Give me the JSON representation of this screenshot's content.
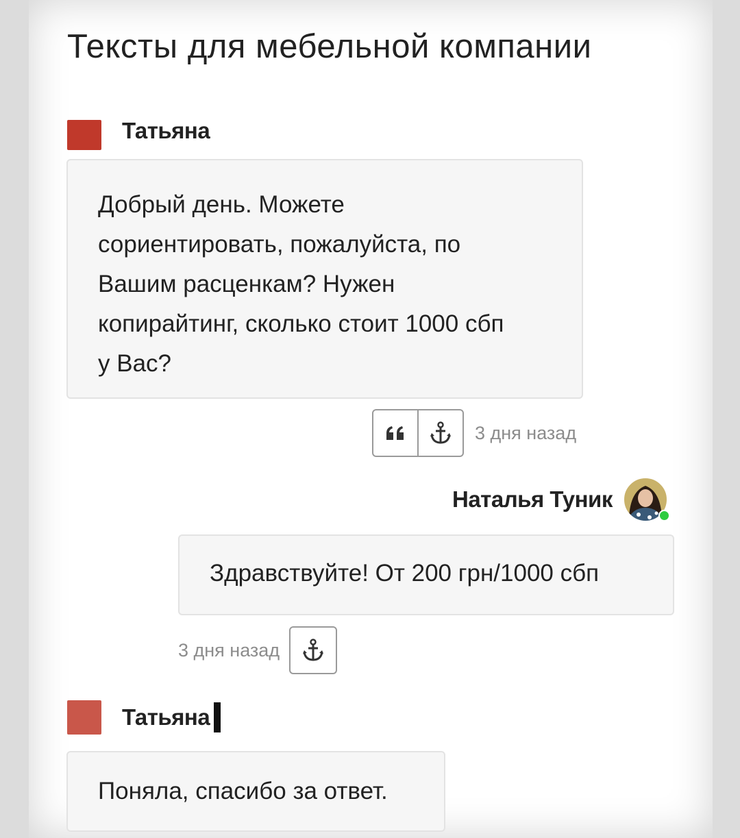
{
  "page": {
    "title": "Тексты для мебельной компании"
  },
  "messages": [
    {
      "author": "Татьяна",
      "text": "Добрый день. Можете сориентировать, пожалуйста, по Вашим расценкам? Нужен копирайтинг, сколько стоит 1000 сбп у Вас?",
      "time": "3 дня назад"
    },
    {
      "author": "Наталья Туник",
      "text": "Здравствуйте! От 200 грн/1000 сбп",
      "time": "3 дня назад"
    },
    {
      "author": "Татьяна",
      "text": "Поняла, спасибо за ответ."
    }
  ],
  "icons": {
    "quote": "quote-icon",
    "anchor": "anchor-icon",
    "avatar_photo": "user-avatar-photo",
    "online": "online-status-dot"
  },
  "colors": {
    "avatar_red": "#c0392b",
    "avatar_red_light": "#c9574a",
    "online_green": "#2ecc40",
    "bubble_bg": "#f6f6f6",
    "time_text": "#8c8c8c"
  }
}
